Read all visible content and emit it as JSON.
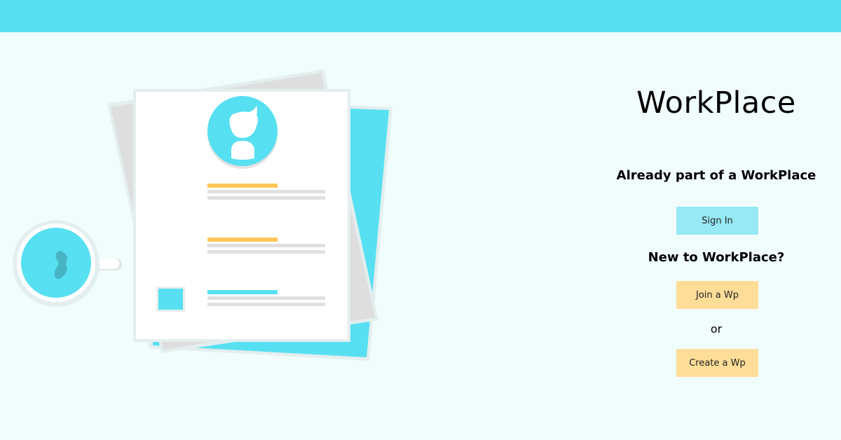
{
  "header": {
    "color": "#57e0f1"
  },
  "illustration": {
    "icon": "resume-documents-with-coffee-cup-illustration"
  },
  "panel": {
    "title": "WorkPlace",
    "existing_heading": "Already part of a WorkPlace",
    "sign_in_label": "Sign In",
    "new_heading": "New to WorkPlace?",
    "join_label": "Join a Wp",
    "or_label": "or",
    "create_label": "Create a Wp"
  },
  "colors": {
    "accent": "#57e0f1",
    "button_blue": "#97e9f5",
    "button_yellow": "#fedd98",
    "highlight_yellow": "#fec659"
  }
}
